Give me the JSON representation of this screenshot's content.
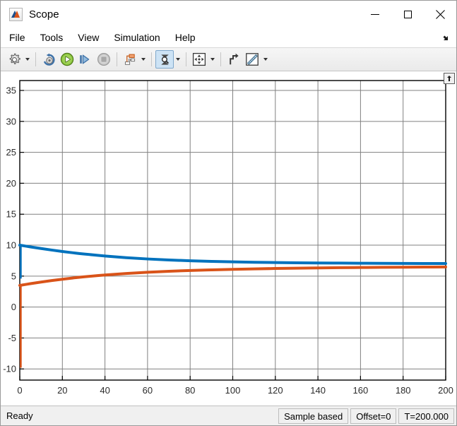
{
  "window": {
    "title": "Scope",
    "app_icon": "matlab-scope-icon",
    "controls": {
      "minimize": "minimize-icon",
      "maximize": "maximize-icon",
      "close": "close-icon"
    }
  },
  "menubar": {
    "items": [
      {
        "label": "File"
      },
      {
        "label": "Tools"
      },
      {
        "label": "View"
      },
      {
        "label": "Simulation"
      },
      {
        "label": "Help"
      }
    ],
    "undock_icon": "undock-arrow-icon"
  },
  "toolbar": {
    "buttons": [
      {
        "name": "configuration-properties",
        "icon": "gear-icon",
        "has_caret": true,
        "active": false
      },
      {
        "name": "rewind-to-start",
        "icon": "rewind-icon",
        "has_caret": false,
        "active": false
      },
      {
        "name": "run-simulation",
        "icon": "play-icon",
        "has_caret": false,
        "active": false
      },
      {
        "name": "step-forward",
        "icon": "step-forward-icon",
        "has_caret": false,
        "active": false
      },
      {
        "name": "stop-simulation",
        "icon": "stop-icon",
        "has_caret": false,
        "active": false
      },
      {
        "name": "signal-selector",
        "icon": "signal-blocks-icon",
        "has_caret": true,
        "active": false
      },
      {
        "name": "zoom-in-tool",
        "icon": "zoom-in-icon",
        "has_caret": true,
        "active": true
      },
      {
        "name": "pan-tool",
        "icon": "pan-arrows-icon",
        "has_caret": true,
        "active": false
      },
      {
        "name": "autoscale",
        "icon": "autoscale-icon",
        "has_caret": false,
        "active": false
      },
      {
        "name": "measurements",
        "icon": "ruler-icon",
        "has_caret": true,
        "active": false
      }
    ]
  },
  "plot": {
    "expand_icon": "expand-arrow-icon"
  },
  "statusbar": {
    "ready_label": "Ready",
    "cells": [
      {
        "name": "sample-mode",
        "label": "Sample based"
      },
      {
        "name": "offset",
        "label": "Offset=0"
      },
      {
        "name": "simulation-time",
        "label": "T=200.000"
      }
    ]
  },
  "chart_data": {
    "type": "line",
    "title": "",
    "xlabel": "",
    "ylabel": "",
    "xlim": [
      0,
      200
    ],
    "ylim": [
      -11.8,
      36.6
    ],
    "xticks": [
      0,
      20,
      40,
      60,
      80,
      100,
      120,
      140,
      160,
      180,
      200
    ],
    "yticks": [
      35,
      30,
      25,
      20,
      15,
      10,
      5,
      0,
      -5,
      -10
    ],
    "grid": true,
    "legend": "none",
    "colors": {
      "series1": "#0072BD",
      "series2": "#D95319",
      "grid": "#808080",
      "axis": "#000000"
    },
    "series": [
      {
        "name": "signal-1",
        "color": "#0072BD",
        "x": [
          0,
          5,
          10,
          15,
          20,
          25,
          30,
          40,
          50,
          60,
          70,
          80,
          90,
          100,
          110,
          120,
          130,
          140,
          150,
          160,
          170,
          180,
          190,
          200
        ],
        "y": [
          10.0,
          9.72,
          9.46,
          9.21,
          8.98,
          8.77,
          8.58,
          8.25,
          7.98,
          7.77,
          7.61,
          7.48,
          7.38,
          7.3,
          7.24,
          7.19,
          7.15,
          7.12,
          7.1,
          7.08,
          7.06,
          7.05,
          7.04,
          7.03
        ]
      },
      {
        "name": "signal-2",
        "color": "#D95319",
        "x": [
          0,
          5,
          10,
          15,
          20,
          25,
          30,
          40,
          50,
          60,
          70,
          80,
          90,
          100,
          110,
          120,
          130,
          140,
          150,
          160,
          170,
          180,
          190,
          200
        ],
        "y": [
          3.5,
          3.78,
          4.04,
          4.28,
          4.5,
          4.7,
          4.88,
          5.18,
          5.42,
          5.62,
          5.78,
          5.91,
          6.01,
          6.1,
          6.17,
          6.23,
          6.28,
          6.32,
          6.36,
          6.39,
          6.42,
          6.44,
          6.46,
          6.48
        ]
      }
    ],
    "annotations": [
      {
        "name": "initial-transient-blue",
        "x": 0,
        "y_from": 10.0,
        "y_to": 4.6,
        "color": "#0072BD"
      },
      {
        "name": "initial-transient-orange",
        "x": 0,
        "y_from": 3.5,
        "y_to": -9.8,
        "color": "#D95319"
      }
    ]
  }
}
